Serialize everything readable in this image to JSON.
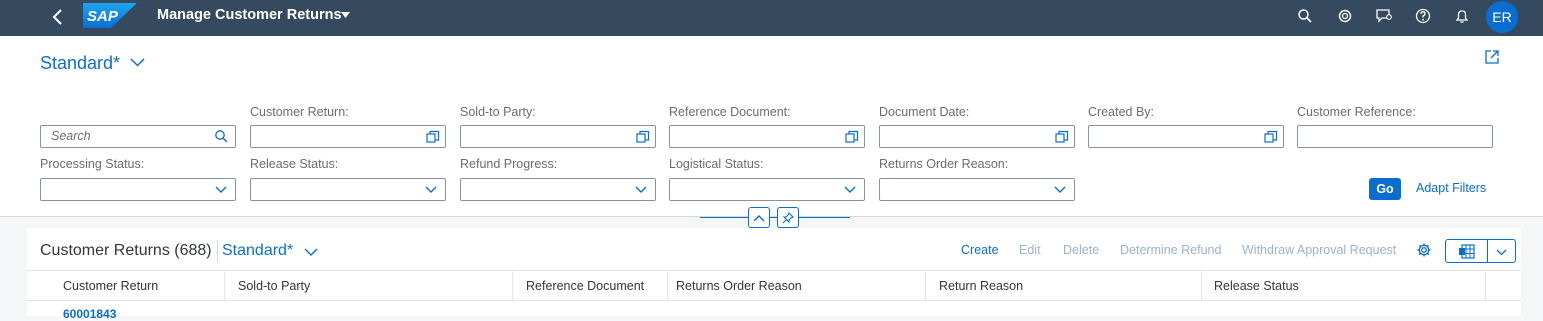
{
  "shell": {
    "logo_text": "SAP",
    "app_title": "Manage Customer Returns",
    "avatar_initials": "ER",
    "icons": [
      "back-icon",
      "search-icon",
      "copilot-icon",
      "feedback-icon",
      "help-icon",
      "notifications-icon"
    ]
  },
  "filterbar": {
    "variant": "Standard*",
    "search_placeholder": "Search",
    "fields_row1": [
      {
        "label": "Customer Return:"
      },
      {
        "label": "Sold-to Party:"
      },
      {
        "label": "Reference Document:"
      },
      {
        "label": "Document Date:"
      },
      {
        "label": "Created By:"
      },
      {
        "label": "Customer Reference:"
      }
    ],
    "fields_row2": [
      {
        "label": "Processing Status:"
      },
      {
        "label": "Release Status:"
      },
      {
        "label": "Refund Progress:"
      },
      {
        "label": "Logistical Status:"
      },
      {
        "label": "Returns Order Reason:"
      }
    ],
    "go_label": "Go",
    "adapt_label": "Adapt Filters"
  },
  "table": {
    "title": "Customer Returns (688)",
    "variant": "Standard*",
    "actions": [
      {
        "label": "Create",
        "enabled": true
      },
      {
        "label": "Edit",
        "enabled": false
      },
      {
        "label": "Delete",
        "enabled": false
      },
      {
        "label": "Determine Refund",
        "enabled": false
      },
      {
        "label": "Withdraw Approval Request",
        "enabled": false
      }
    ],
    "columns": [
      "Customer Return",
      "Sold-to Party",
      "Reference Document",
      "Returns Order Reason",
      "Return Reason",
      "Release Status"
    ],
    "rows": [
      {
        "customer_return": "60001843"
      }
    ]
  },
  "colors": {
    "shell": "#354a5f",
    "accent": "#0a6ed1",
    "disabled": "#9ab3cf"
  }
}
